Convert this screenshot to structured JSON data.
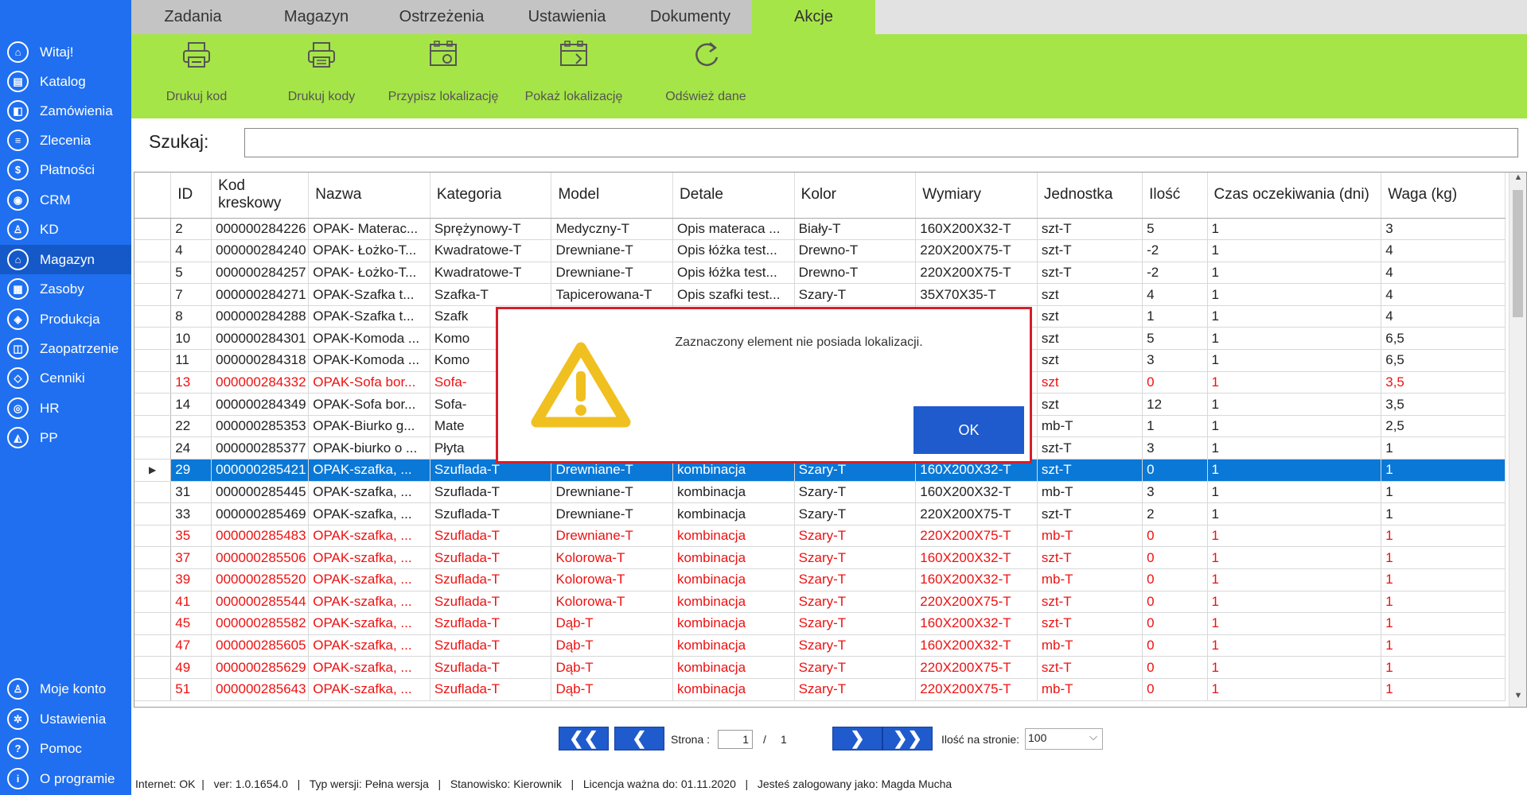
{
  "sidebar": {
    "items": [
      {
        "label": "Witaj!",
        "icon": "home-icon",
        "glyph": "⌂"
      },
      {
        "label": "Katalog",
        "icon": "book-icon",
        "glyph": "▤"
      },
      {
        "label": "Zamówienia",
        "icon": "cart-icon",
        "glyph": "◧"
      },
      {
        "label": "Zlecenia",
        "icon": "list-icon",
        "glyph": "≡"
      },
      {
        "label": "Płatności",
        "icon": "dollar-icon",
        "glyph": "$"
      },
      {
        "label": "CRM",
        "icon": "crm-icon",
        "glyph": "◉"
      },
      {
        "label": "KD",
        "icon": "user-icon",
        "glyph": "♙"
      },
      {
        "label": "Magazyn",
        "icon": "warehouse-icon",
        "glyph": "⌂"
      },
      {
        "label": "Zasoby",
        "icon": "resources-icon",
        "glyph": "▦"
      },
      {
        "label": "Produkcja",
        "icon": "production-icon",
        "glyph": "◈"
      },
      {
        "label": "Zaopatrzenie",
        "icon": "truck-icon",
        "glyph": "◫"
      },
      {
        "label": "Cenniki",
        "icon": "tag-icon",
        "glyph": "◇"
      },
      {
        "label": "HR",
        "icon": "hr-icon",
        "glyph": "◎"
      },
      {
        "label": "PP",
        "icon": "chart-icon",
        "glyph": "◭"
      }
    ],
    "bottom": [
      {
        "label": "Moje konto",
        "icon": "account-icon",
        "glyph": "♙"
      },
      {
        "label": "Ustawienia",
        "icon": "gear-icon",
        "glyph": "✲"
      },
      {
        "label": "Pomoc",
        "icon": "help-icon",
        "glyph": "?"
      },
      {
        "label": "O programie",
        "icon": "info-icon",
        "glyph": "i"
      }
    ]
  },
  "tabs": [
    "Zadania",
    "Magazyn",
    "Ostrzeżenia",
    "Ustawienia",
    "Dokumenty",
    "Akcje"
  ],
  "ribbon": [
    "Drukuj kod",
    "Drukuj kody",
    "Przypisz lokalizację",
    "Pokaż lokalizację",
    "Odśwież dane"
  ],
  "search": {
    "label": "Szukaj:",
    "value": ""
  },
  "table": {
    "headers": [
      "ID",
      "Kod kreskowy",
      "Nazwa",
      "Kategoria",
      "Model",
      "Detale",
      "Kolor",
      "Wymiary",
      "Jednostka",
      "Ilość",
      "Czas oczekiwania (dni)",
      "Waga (kg)"
    ],
    "rows": [
      {
        "c": [
          "2",
          "000000284226",
          "OPAK- Materac...",
          "Sprężynowy-T",
          "Medyczny-T",
          "Opis materaca ...",
          "Biały-T",
          "160X200X32-T",
          "szt-T",
          "5",
          "1",
          "3"
        ]
      },
      {
        "c": [
          "4",
          "000000284240",
          "OPAK- Łożko-T...",
          "Kwadratowe-T",
          "Drewniane-T",
          "Opis łóżka test...",
          "Drewno-T",
          "220X200X75-T",
          "szt-T",
          "-2",
          "1",
          "4"
        ]
      },
      {
        "c": [
          "5",
          "000000284257",
          "OPAK- Łożko-T...",
          "Kwadratowe-T",
          "Drewniane-T",
          "Opis łóżka test...",
          "Drewno-T",
          "220X200X75-T",
          "szt-T",
          "-2",
          "1",
          "4"
        ]
      },
      {
        "c": [
          "7",
          "000000284271",
          "OPAK-Szafka t...",
          "Szafka-T",
          "Tapicerowana-T",
          "Opis szafki test...",
          "Szary-T",
          "35X70X35-T",
          "szt",
          "4",
          "1",
          "4"
        ]
      },
      {
        "c": [
          "8",
          "000000284288",
          "OPAK-Szafka t...",
          "Szafk",
          "",
          "",
          "",
          "",
          "szt",
          "1",
          "1",
          "4"
        ]
      },
      {
        "c": [
          "10",
          "000000284301",
          "OPAK-Komoda ...",
          "Komo",
          "",
          "",
          "",
          "",
          "szt",
          "5",
          "1",
          "6,5"
        ]
      },
      {
        "c": [
          "11",
          "000000284318",
          "OPAK-Komoda ...",
          "Komo",
          "",
          "",
          "",
          "",
          "szt",
          "3",
          "1",
          "6,5"
        ]
      },
      {
        "c": [
          "13",
          "000000284332",
          "OPAK-Sofa bor...",
          "Sofa-",
          "",
          "",
          "",
          "",
          "szt",
          "0",
          "1",
          "3,5"
        ],
        "red": true
      },
      {
        "c": [
          "14",
          "000000284349",
          "OPAK-Sofa bor...",
          "Sofa-",
          "",
          "",
          "",
          "",
          "szt",
          "12",
          "1",
          "3,5"
        ]
      },
      {
        "c": [
          "22",
          "000000285353",
          "OPAK-Biurko g...",
          "Mate",
          "",
          "",
          "",
          "",
          "mb-T",
          "1",
          "1",
          "2,5"
        ]
      },
      {
        "c": [
          "24",
          "000000285377",
          "OPAK-biurko o ...",
          "Płyta",
          "",
          "",
          "",
          "",
          "szt-T",
          "3",
          "1",
          "1"
        ]
      },
      {
        "c": [
          "29",
          "000000285421",
          "OPAK-szafka, ...",
          "Szuflada-T",
          "Drewniane-T",
          "kombinacja",
          "Szary-T",
          "160X200X32-T",
          "szt-T",
          "0",
          "1",
          "1"
        ],
        "sel": true
      },
      {
        "c": [
          "31",
          "000000285445",
          "OPAK-szafka, ...",
          "Szuflada-T",
          "Drewniane-T",
          "kombinacja",
          "Szary-T",
          "160X200X32-T",
          "mb-T",
          "3",
          "1",
          "1"
        ]
      },
      {
        "c": [
          "33",
          "000000285469",
          "OPAK-szafka, ...",
          "Szuflada-T",
          "Drewniane-T",
          "kombinacja",
          "Szary-T",
          "220X200X75-T",
          "szt-T",
          "2",
          "1",
          "1"
        ]
      },
      {
        "c": [
          "35",
          "000000285483",
          "OPAK-szafka, ...",
          "Szuflada-T",
          "Drewniane-T",
          "kombinacja",
          "Szary-T",
          "220X200X75-T",
          "mb-T",
          "0",
          "1",
          "1"
        ],
        "red": true
      },
      {
        "c": [
          "37",
          "000000285506",
          "OPAK-szafka, ...",
          "Szuflada-T",
          "Kolorowa-T",
          "kombinacja",
          "Szary-T",
          "160X200X32-T",
          "szt-T",
          "0",
          "1",
          "1"
        ],
        "red": true
      },
      {
        "c": [
          "39",
          "000000285520",
          "OPAK-szafka, ...",
          "Szuflada-T",
          "Kolorowa-T",
          "kombinacja",
          "Szary-T",
          "160X200X32-T",
          "mb-T",
          "0",
          "1",
          "1"
        ],
        "red": true
      },
      {
        "c": [
          "41",
          "000000285544",
          "OPAK-szafka, ...",
          "Szuflada-T",
          "Kolorowa-T",
          "kombinacja",
          "Szary-T",
          "220X200X75-T",
          "szt-T",
          "0",
          "1",
          "1"
        ],
        "red": true
      },
      {
        "c": [
          "45",
          "000000285582",
          "OPAK-szafka, ...",
          "Szuflada-T",
          "Dąb-T",
          "kombinacja",
          "Szary-T",
          "160X200X32-T",
          "szt-T",
          "0",
          "1",
          "1"
        ],
        "red": true
      },
      {
        "c": [
          "47",
          "000000285605",
          "OPAK-szafka, ...",
          "Szuflada-T",
          "Dąb-T",
          "kombinacja",
          "Szary-T",
          "160X200X32-T",
          "mb-T",
          "0",
          "1",
          "1"
        ],
        "red": true
      },
      {
        "c": [
          "49",
          "000000285629",
          "OPAK-szafka, ...",
          "Szuflada-T",
          "Dąb-T",
          "kombinacja",
          "Szary-T",
          "220X200X75-T",
          "szt-T",
          "0",
          "1",
          "1"
        ],
        "red": true
      },
      {
        "c": [
          "51",
          "000000285643",
          "OPAK-szafka, ...",
          "Szuflada-T",
          "Dąb-T",
          "kombinacja",
          "Szary-T",
          "220X200X75-T",
          "mb-T",
          "0",
          "1",
          "1"
        ],
        "red": true
      }
    ]
  },
  "pager": {
    "page_label": "Strona :",
    "page": "1",
    "separator": "/",
    "total": "1",
    "size_label": "Ilość na stronie:",
    "size": "100"
  },
  "status": "Internet: OK  |   ver: 1.0.1654.0   |   Typ wersji: Pełna wersja   |   Stanowisko: Kierownik   |   Licencja ważna do: 01.11.2020   |   Jesteś zalogowany jako: Magda Mucha",
  "dialog": {
    "message": "Zaznaczony element nie posiada lokalizacji.",
    "ok": "OK"
  },
  "colors": {
    "sidebar": "#1f6ff0",
    "ribbon": "#a6e548",
    "selected_row": "#0a78d7",
    "error_text": "#e11111",
    "dialog_border": "#d61e2a"
  }
}
